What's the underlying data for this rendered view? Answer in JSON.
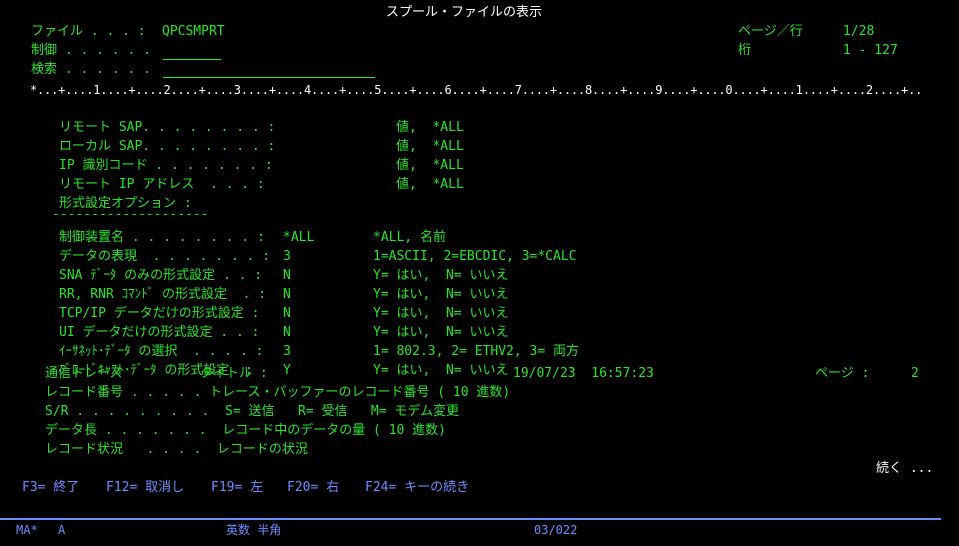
{
  "screen": {
    "title": "スプール・ファイルの表示",
    "file_label": "ファイル . . . :",
    "file_value": "QPCSMPRT",
    "control_label": "制御 . . . . . .",
    "search_label": "検索 . . . . . .",
    "page_row_label": "ページ／行",
    "page_row_value": "1/28",
    "column_label": "桁",
    "column_value": "1 - 127",
    "ruler": "*...+....1....+....2....+....3....+....4....+....5....+....6....+....7....+....8....+....9....+....0....+....1....+....2....+.."
  },
  "options": [
    {
      "label": "リモート SAP. . . . . . . . :",
      "c2": "",
      "c3": "値,  *ALL"
    },
    {
      "label": "ローカル SAP. . . . . . . . :",
      "c2": "",
      "c3": "値,  *ALL"
    },
    {
      "label": "IP 識別コード . . . . . . . :",
      "c2": "",
      "c3": "値,  *ALL"
    },
    {
      "label": "リモート IP アドレス  . . . :",
      "c2": "",
      "c3": "値,  *ALL"
    },
    {
      "label": "形式設定オプション :",
      "c2": "",
      "c3": ""
    },
    {
      "label": "--------------------",
      "c2": "",
      "c3": ""
    },
    {
      "label": "制御装置名 . . . . . . . . :",
      "c2": "*ALL",
      "c3": "*ALL, 名前"
    },
    {
      "label": "データの表現  . . . . . . . :",
      "c2": "3",
      "c3": "1=ASCII, 2=EBCDIC, 3=*CALC"
    },
    {
      "label": "SNA ﾃﾞｰﾀ のみの形式設定 . . :",
      "c2": "N",
      "c3": "Y= はい,  N= いいえ"
    },
    {
      "label": "RR, RNR ｺﾏﾝﾄﾞ の形式設定  . :",
      "c2": "N",
      "c3": "Y= はい,  N= いいえ"
    },
    {
      "label": "TCP/IP データだけの形式設定 :",
      "c2": "N",
      "c3": "Y= はい,  N= いいえ"
    },
    {
      "label": "UI データだけの形式設定 . . :",
      "c2": "N",
      "c3": "Y= はい,  N= いいえ"
    },
    {
      "label": "ｲｰｻﾈｯﾄ･ﾃﾞｰﾀ の選択  . . . . :",
      "c2": "3",
      "c3": "1= 802.3, 2= ETHV2, 3= 両方"
    },
    {
      "label": "ﾌﾞﾛｰﾄﾞｷｬｽﾄ･ﾃﾞｰﾀ の形式設定  :",
      "c2": "Y",
      "c3": "Y= はい,  N= いいえ"
    }
  ],
  "trace": {
    "header_name": "通信トレース",
    "header_title": "タイトル :",
    "header_datetime": "19/07/23  16:57:23",
    "header_page_label": "ページ :",
    "header_page_value": "2",
    "lines": [
      "レコード番号 . . . . . トレース・バッファーのレコード番号 ( 10 進数)",
      "S/R . . . . . . . . .  S= 送信   R= 受信   M= モデム変更",
      "データ長 . . . . . . .  レコード中のデータの量 ( 10 進数)",
      "レコード状況   . . . .  レコードの状況"
    ],
    "more": "続く ..."
  },
  "fkeys": [
    {
      "label": "F3= 終了"
    },
    {
      "label": "F12= 取消し"
    },
    {
      "label": "F19= 左"
    },
    {
      "label": "F20= 右"
    },
    {
      "label": "F24= キーの続き"
    }
  ],
  "status": {
    "session": "MA*",
    "indicator": "A",
    "input_mode": "英数 半角",
    "cursor": "03/022"
  },
  "colors": {
    "field": "#28e328",
    "title": "#ffffff",
    "keys": "#6f8cff"
  }
}
